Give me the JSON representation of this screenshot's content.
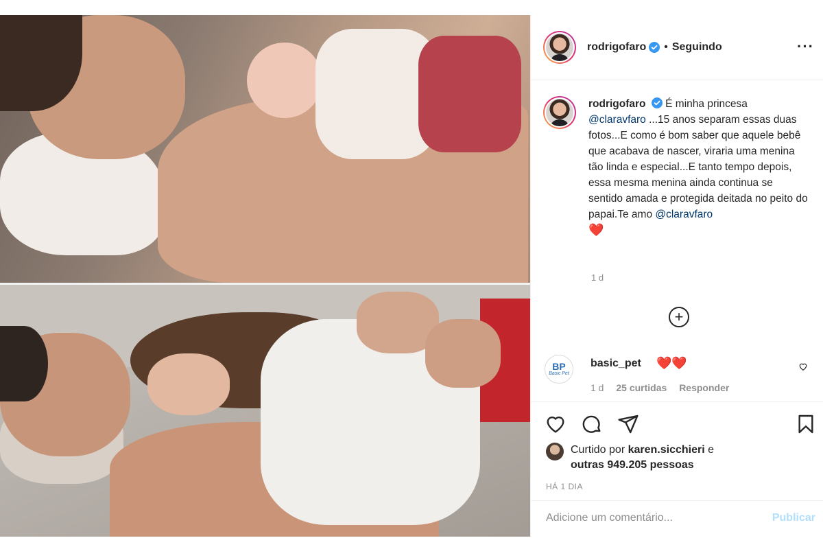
{
  "post": {
    "author": "rodrigofaro",
    "separator": "•",
    "follow_status": "Seguindo",
    "more": "..."
  },
  "caption": {
    "author": "rodrigofaro",
    "text_1": "É minha princesa",
    "mention_1": "@claravfaro",
    "text_2": "...15 anos separam essas duas fotos...E como é bom saber que aquele bebê que acabava de nascer, viraria uma menina tão linda e especial...E tanto tempo depois, essa mesma menina ainda continua se sentido amada e protegida deitada no peito do papai.Te amo",
    "mention_2": "@claravfaro",
    "emoji": "❤️",
    "time": "1 d"
  },
  "comment": {
    "user": "basic_pet",
    "body": "❤️❤️",
    "time": "1 d",
    "likes": "25 curtidas",
    "reply": "Responder",
    "avatar_mark": "BP",
    "avatar_text": "Basic Pet"
  },
  "likes": {
    "prefix": "Curtido por",
    "user": "karen.sicchieri",
    "middle": "e",
    "count": "outras 949.205 pessoas"
  },
  "post_age": "HÁ 1 DIA",
  "comment_box": {
    "placeholder": "Adicione um comentário...",
    "publish": "Publicar"
  },
  "colors": {
    "verified": "#3897f0",
    "heart": "#e0245e",
    "publish_disabled": "#b2dffc",
    "mention": "#00376b"
  }
}
